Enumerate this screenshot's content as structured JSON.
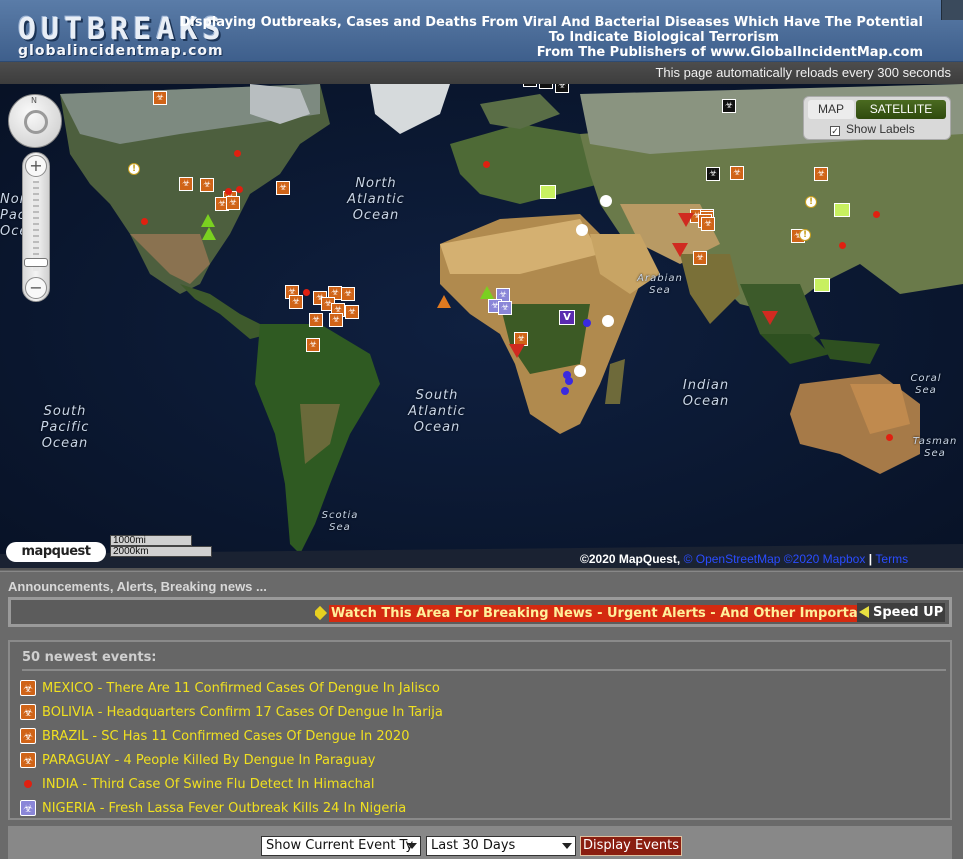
{
  "header": {
    "logo_main": "OUTBREAKS",
    "logo_sub": "globalincidentmap.com",
    "tagline_line1": "Displaying Outbreaks, Cases and Deaths From Viral And Bacterial Diseases Which Have The Potential",
    "tagline_line2": "To Indicate Biological Terrorism",
    "tagline_line3": "From The Publishers of www.GlobalIncidentMap.com",
    "reload_notice": "This page automatically reloads every 300 seconds"
  },
  "map": {
    "map_type_map": "MAP",
    "map_type_satellite": "SATELLITE",
    "show_labels": "Show Labels",
    "show_labels_checked": true,
    "compass_north": "N",
    "zoom_in": "+",
    "zoom_out": "−",
    "scale_mi": "1000mi",
    "scale_km": "2000km",
    "logo": "mapquest",
    "copyright": "©2020 MapQuest,",
    "copyright_link1": "© OpenStreetMap",
    "copyright_link2": "©2020 Mapbox",
    "copyright_sep": "|",
    "copyright_link3": "Terms",
    "ocean_labels": {
      "north_atlantic": [
        "North",
        "Atlantic",
        "Ocean"
      ],
      "south_atlantic": [
        "South",
        "Atlantic",
        "Ocean"
      ],
      "south_pacific": [
        "South",
        "Pacific",
        "Ocean"
      ],
      "north_pacific": [
        "North",
        "Pacific",
        "Ocean"
      ],
      "indian": [
        "Indian",
        "Ocean"
      ],
      "arabian": [
        "Arabian",
        "Sea"
      ],
      "coral": [
        "Coral Sea"
      ],
      "tasman": [
        "Tasman",
        "Sea"
      ],
      "scotia": [
        "Scotia",
        "Sea"
      ]
    }
  },
  "announcements": {
    "title": "Announcements, Alerts, Breaking news ...",
    "ticker_text": "Watch This Area For Breaking News - Urgent Alerts - And Other Important",
    "speed_up": "Speed UP"
  },
  "events": {
    "title": "50 newest events:",
    "items": [
      {
        "icon": "biohazard-icon",
        "text": "MEXICO - There Are 11 Confirmed Cases Of Dengue In Jalisco"
      },
      {
        "icon": "biohazard-icon",
        "text": "BOLIVIA - Headquarters Confirm 17 Cases Of Dengue In Tarija"
      },
      {
        "icon": "biohazard-icon",
        "text": "BRAZIL - SC Has 11 Confirmed Cases Of Dengue In 2020"
      },
      {
        "icon": "biohazard-icon",
        "text": "PARAGUAY - 4 People Killed By Dengue In Paraguay"
      },
      {
        "icon": "red-dot-icon",
        "text": "INDIA - Third Case Of Swine Flu Detect In Himachal"
      },
      {
        "icon": "purple-biohazard-icon",
        "text": "NIGERIA - Fresh Lassa Fever Outbreak Kills 24 In Nigeria"
      }
    ]
  },
  "filters": {
    "event_type": "Show Current Event Ty",
    "period": "Last 30 Days",
    "display_button": "Display Events"
  },
  "colors": {
    "header_blue": "#4b6c98",
    "ticker_red": "#d42a10",
    "event_yellow": "#f0e020",
    "biohazard_orange": "#d06418"
  }
}
